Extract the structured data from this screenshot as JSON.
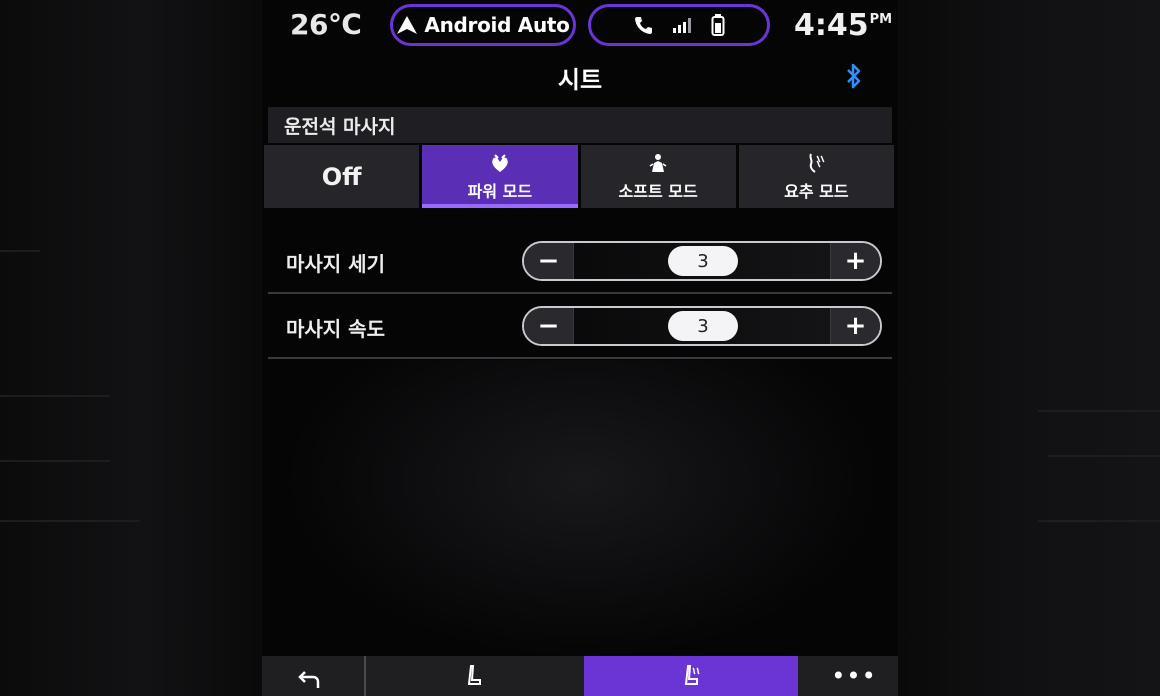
{
  "status": {
    "temperature": "26℃",
    "android_auto_label": "Android Auto",
    "clock_time": "4:45",
    "clock_period": "PM"
  },
  "header": {
    "title": "시트"
  },
  "section": {
    "title": "운전석 마사지"
  },
  "modes": [
    {
      "label": "Off",
      "icon": "none",
      "selected": false
    },
    {
      "label": "파워 모드",
      "icon": "power-massage-icon",
      "selected": true
    },
    {
      "label": "소프트 모드",
      "icon": "soft-massage-icon",
      "selected": false
    },
    {
      "label": "요추 모드",
      "icon": "lumbar-massage-icon",
      "selected": false
    }
  ],
  "settings": {
    "intensity": {
      "label": "마사지 세기",
      "value": "3"
    },
    "speed": {
      "label": "마사지 속도",
      "value": "3"
    }
  },
  "controls": {
    "minus": "−",
    "plus": "+",
    "more": "•••"
  },
  "colors": {
    "accent": "#6b35d6",
    "selected_bg": "#5a2fb6",
    "bluetooth": "#2f8fff",
    "panel": "#26262a"
  }
}
